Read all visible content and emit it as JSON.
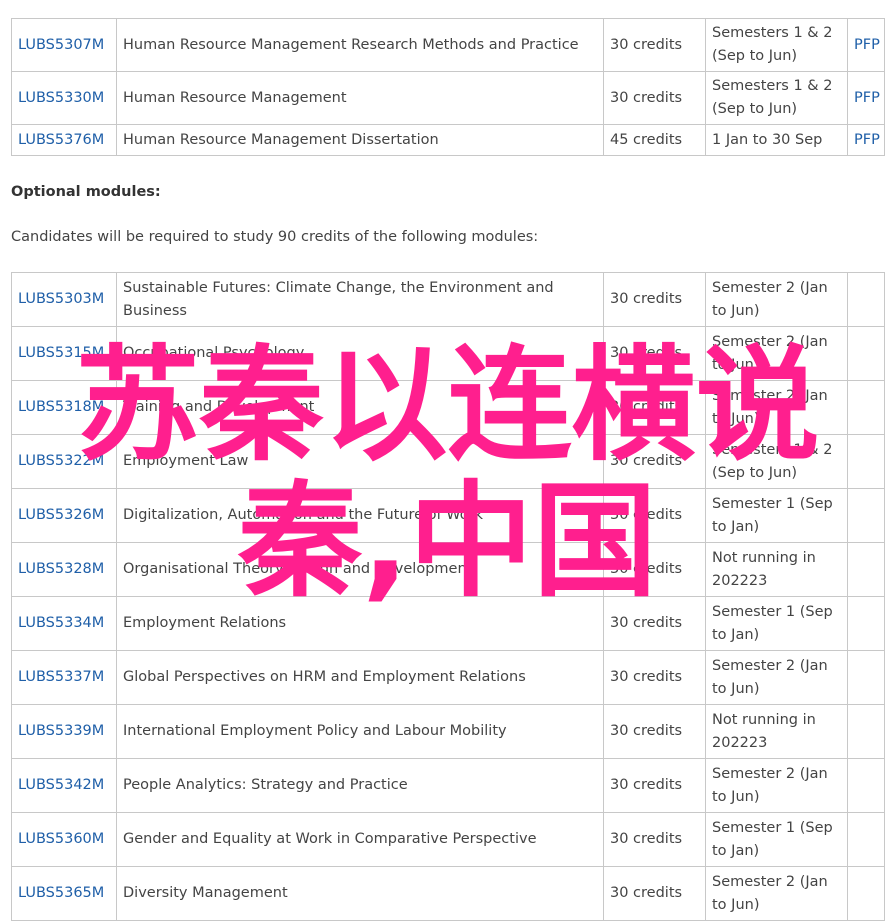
{
  "core_modules": [
    {
      "code": "LUBS5307M",
      "title": "Human Resource Management Research Methods and Practice",
      "credits": "30 credits",
      "semester": "Semesters 1 & 2 (Sep to Jun)",
      "pfp": "PFP"
    },
    {
      "code": "LUBS5330M",
      "title": "Human Resource Management",
      "credits": "30 credits",
      "semester": "Semesters 1 & 2 (Sep to Jun)",
      "pfp": "PFP"
    },
    {
      "code": "LUBS5376M",
      "title": "Human Resource Management Dissertation",
      "credits": "45 credits",
      "semester": "1 Jan to 30 Sep",
      "pfp": "PFP"
    }
  ],
  "optional": {
    "heading": "Optional modules:",
    "intro": "Candidates will be required to study 90 credits of the following modules:"
  },
  "optional_modules": [
    {
      "code": "LUBS5303M",
      "title": "Sustainable Futures: Climate Change, the Environment and Business",
      "credits": "30 credits",
      "semester": "Semester 2 (Jan to Jun)"
    },
    {
      "code": "LUBS5315M",
      "title": "Occupational Psychology",
      "credits": "30 credits",
      "semester": "Semester 2 (Jan to Jun)"
    },
    {
      "code": "LUBS5318M",
      "title": "Training and Development",
      "credits": "30 credits",
      "semester": "Semester 2 (Jan to Jun)"
    },
    {
      "code": "LUBS5322M",
      "title": "Employment Law",
      "credits": "30 credits",
      "semester": "Semesters 1 & 2 (Sep to Jun)"
    },
    {
      "code": "LUBS5326M",
      "title": "Digitalization, Automation and the Future of Work",
      "credits": "30 credits",
      "semester": "Semester 1 (Sep to Jan)"
    },
    {
      "code": "LUBS5328M",
      "title": "Organisational Theory Design and Development",
      "credits": "30 credits",
      "semester": "Not running in 202223"
    },
    {
      "code": "LUBS5334M",
      "title": "Employment Relations",
      "credits": "30 credits",
      "semester": "Semester 1 (Sep to Jan)"
    },
    {
      "code": "LUBS5337M",
      "title": "Global Perspectives on HRM and Employment Relations",
      "credits": "30 credits",
      "semester": "Semester 2 (Jan to Jun)"
    },
    {
      "code": "LUBS5339M",
      "title": "International Employment Policy and Labour Mobility",
      "credits": "30 credits",
      "semester": "Not running in 202223"
    },
    {
      "code": "LUBS5342M",
      "title": "People Analytics: Strategy and Practice",
      "credits": "30 credits",
      "semester": "Semester 2 (Jan to Jun)"
    },
    {
      "code": "LUBS5360M",
      "title": "Gender and Equality at Work in Comparative Perspective",
      "credits": "30 credits",
      "semester": "Semester 1 (Sep to Jan)"
    },
    {
      "code": "LUBS5365M",
      "title": "Diversity Management",
      "credits": "30 credits",
      "semester": "Semester 2 (Jan to Jun)"
    }
  ],
  "watermark": {
    "line1": "苏秦以连横说",
    "line2": "秦,中国",
    "color": "#ff1f8e"
  }
}
